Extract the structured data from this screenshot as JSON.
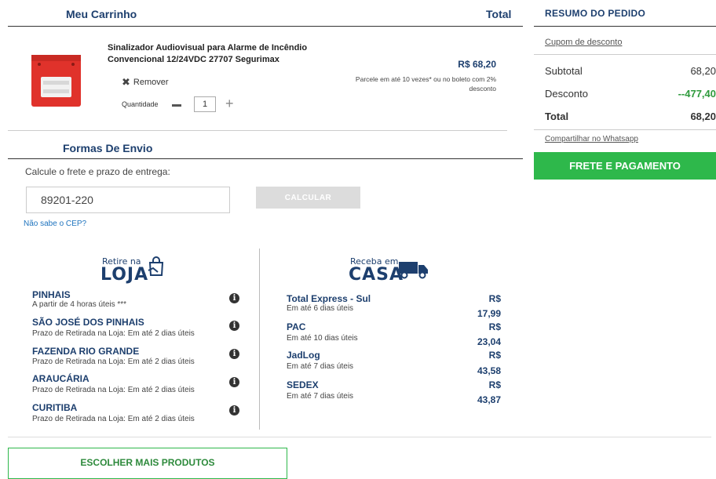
{
  "cart": {
    "title": "Meu Carrinho",
    "total_header": "Total",
    "product": {
      "name": "Sinalizador Audiovisual para Alarme de Incêndio Convencional 12/24VDC 27707 Segurimax",
      "price": "R$ 68,20",
      "installments": "Parcele em até 10 vezes* ou no boleto com 2% desconto",
      "remove_label": "Remover",
      "quantity_label": "Quantidade",
      "quantity": "1"
    }
  },
  "shipping": {
    "title": "Formas De Envio",
    "calc_label": "Calcule o frete e prazo de entrega:",
    "cep_value": "89201-220",
    "calc_button": "CALCULAR",
    "no_cep_link": "Não sabe o CEP?",
    "pickup_logo_small": "Retire na",
    "pickup_logo_big": "LOJA",
    "home_logo_small": "Receba em",
    "home_logo_big": "CASA",
    "stores": [
      {
        "name": "PINHAIS",
        "desc": "A partir de 4 horas úteis ***"
      },
      {
        "name": "SÃO JOSÉ DOS PINHAIS",
        "desc": "Prazo de Retirada na Loja: Em até 2 dias úteis"
      },
      {
        "name": "FAZENDA RIO GRANDE",
        "desc": "Prazo de Retirada na Loja: Em até 2 dias úteis"
      },
      {
        "name": "ARAUCÁRIA",
        "desc": "Prazo de Retirada na Loja: Em até 2 dias úteis"
      },
      {
        "name": "CURITIBA",
        "desc": "Prazo de Retirada na Loja: Em até 2 dias úteis"
      }
    ],
    "carriers": [
      {
        "name": "Total Express - Sul",
        "desc": "Em até 6 dias úteis",
        "currency": "R$",
        "price": "17,99"
      },
      {
        "name": "PAC",
        "desc": "Em até 10 dias úteis",
        "currency": "R$",
        "price": "23,04"
      },
      {
        "name": "JadLog",
        "desc": "Em até 7 dias úteis",
        "currency": "R$",
        "price": "43,58"
      },
      {
        "name": "SEDEX",
        "desc": "Em até 7 dias úteis",
        "currency": "R$",
        "price": "43,87"
      }
    ],
    "more_products_button": "ESCOLHER MAIS PRODUTOS"
  },
  "summary": {
    "title": "RESUMO DO PEDIDO",
    "coupon_link": "Cupom de desconto",
    "subtotal_label": "Subtotal",
    "subtotal_value": "68,20",
    "discount_label": "Desconto",
    "discount_value": "--477,40",
    "total_label": "Total",
    "total_value": "68,20",
    "share_link": "Compartilhar no Whatsapp",
    "pay_button": "FRETE E PAGAMENTO"
  },
  "colors": {
    "navy": "#1d3f6e",
    "green": "#2eb84b",
    "product_red": "#e0322b"
  }
}
